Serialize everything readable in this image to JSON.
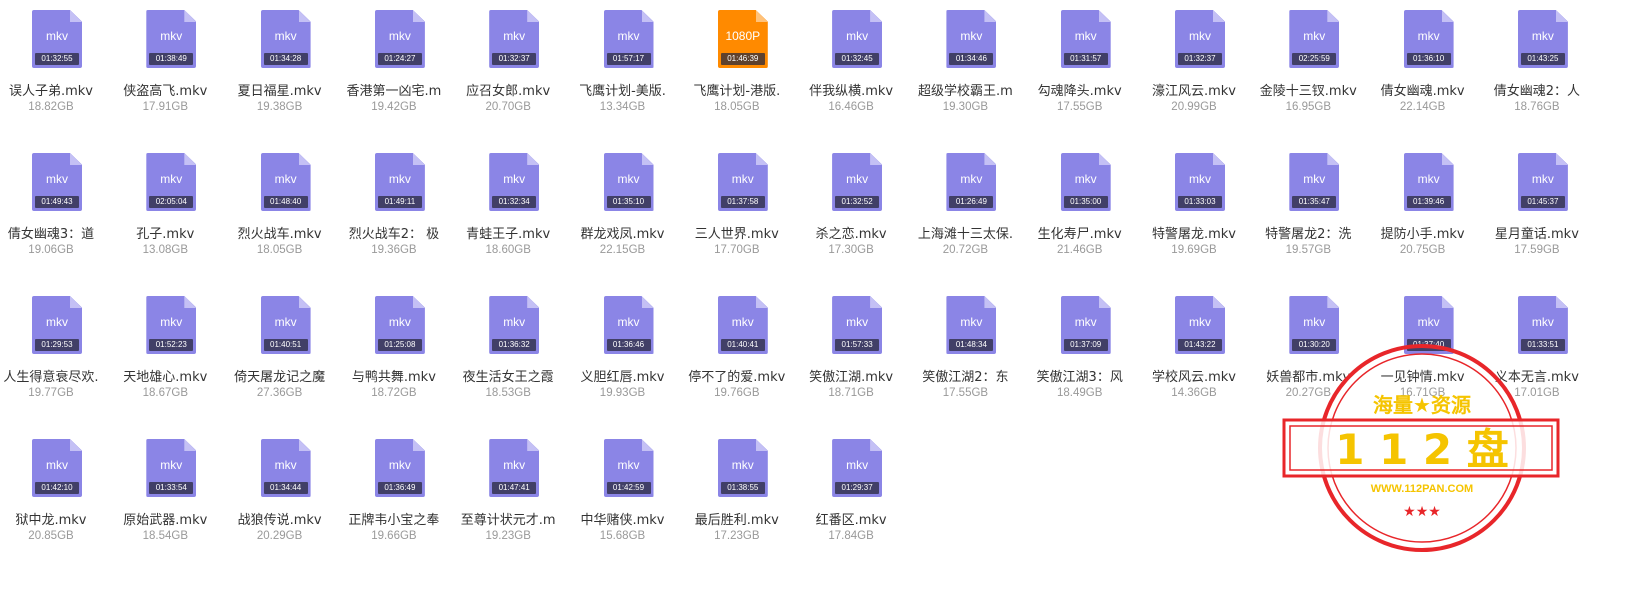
{
  "files": [
    {
      "name": "误人子弟.mkv",
      "size": "18.82GB",
      "duration": "01:32:55",
      "ext": "mkv"
    },
    {
      "name": "侠盗高飞.mkv",
      "size": "17.91GB",
      "duration": "01:38:49",
      "ext": "mkv"
    },
    {
      "name": "夏日福星.mkv",
      "size": "19.38GB",
      "duration": "01:34:28",
      "ext": "mkv"
    },
    {
      "name": "香港第一凶宅.m",
      "size": "19.42GB",
      "duration": "01:24:27",
      "ext": "mkv"
    },
    {
      "name": "应召女郎.mkv",
      "size": "20.70GB",
      "duration": "01:32:37",
      "ext": "mkv"
    },
    {
      "name": "飞鹰计划-美版.",
      "size": "13.34GB",
      "duration": "01:57:17",
      "ext": "mkv"
    },
    {
      "name": "飞鹰计划-港版.",
      "size": "18.05GB",
      "duration": "01:46:39",
      "ext": "1080P",
      "accent": "orange"
    },
    {
      "name": "伴我纵横.mkv",
      "size": "16.46GB",
      "duration": "01:32:45",
      "ext": "mkv"
    },
    {
      "name": "超级学校霸王.m",
      "size": "19.30GB",
      "duration": "01:34:46",
      "ext": "mkv"
    },
    {
      "name": "勾魂降头.mkv",
      "size": "17.55GB",
      "duration": "01:31:57",
      "ext": "mkv"
    },
    {
      "name": "濠江风云.mkv",
      "size": "20.99GB",
      "duration": "01:32:37",
      "ext": "mkv"
    },
    {
      "name": "金陵十三钗.mkv",
      "size": "16.95GB",
      "duration": "02:25:59",
      "ext": "mkv"
    },
    {
      "name": "倩女幽魂.mkv",
      "size": "22.14GB",
      "duration": "01:36:10",
      "ext": "mkv"
    },
    {
      "name": "倩女幽魂2：人",
      "size": "18.76GB",
      "duration": "01:43:25",
      "ext": "mkv"
    },
    {
      "name": "倩女幽魂3：道",
      "size": "19.06GB",
      "duration": "01:49:43",
      "ext": "mkv"
    },
    {
      "name": "孔子.mkv",
      "size": "13.08GB",
      "duration": "02:05:04",
      "ext": "mkv"
    },
    {
      "name": "烈火战车.mkv",
      "size": "18.05GB",
      "duration": "01:48:40",
      "ext": "mkv"
    },
    {
      "name": "烈火战车2： 极",
      "size": "19.36GB",
      "duration": "01:49:11",
      "ext": "mkv"
    },
    {
      "name": "青蛙王子.mkv",
      "size": "18.60GB",
      "duration": "01:32:34",
      "ext": "mkv"
    },
    {
      "name": "群龙戏凤.mkv",
      "size": "22.15GB",
      "duration": "01:35:10",
      "ext": "mkv"
    },
    {
      "name": "三人世界.mkv",
      "size": "17.70GB",
      "duration": "01:37:58",
      "ext": "mkv"
    },
    {
      "name": "杀之恋.mkv",
      "size": "17.30GB",
      "duration": "01:32:52",
      "ext": "mkv"
    },
    {
      "name": "上海滩十三太保.",
      "size": "20.72GB",
      "duration": "01:26:49",
      "ext": "mkv"
    },
    {
      "name": "生化寿尸.mkv",
      "size": "21.46GB",
      "duration": "01:35:00",
      "ext": "mkv"
    },
    {
      "name": "特警屠龙.mkv",
      "size": "19.69GB",
      "duration": "01:33:03",
      "ext": "mkv"
    },
    {
      "name": "特警屠龙2：洗",
      "size": "19.57GB",
      "duration": "01:35:47",
      "ext": "mkv"
    },
    {
      "name": "提防小手.mkv",
      "size": "20.75GB",
      "duration": "01:39:46",
      "ext": "mkv"
    },
    {
      "name": "星月童话.mkv",
      "size": "17.59GB",
      "duration": "01:45:37",
      "ext": "mkv"
    },
    {
      "name": "人生得意衰尽欢.",
      "size": "19.77GB",
      "duration": "01:29:53",
      "ext": "mkv"
    },
    {
      "name": "天地雄心.mkv",
      "size": "18.67GB",
      "duration": "01:52:23",
      "ext": "mkv"
    },
    {
      "name": "倚天屠龙记之魔",
      "size": "27.36GB",
      "duration": "01:40:51",
      "ext": "mkv"
    },
    {
      "name": "与鸭共舞.mkv",
      "size": "18.72GB",
      "duration": "01:25:08",
      "ext": "mkv"
    },
    {
      "name": "夜生活女王之霞",
      "size": "18.53GB",
      "duration": "01:36:32",
      "ext": "mkv"
    },
    {
      "name": "义胆红唇.mkv",
      "size": "19.93GB",
      "duration": "01:36:46",
      "ext": "mkv"
    },
    {
      "name": "停不了的爱.mkv",
      "size": "19.76GB",
      "duration": "01:40:41",
      "ext": "mkv"
    },
    {
      "name": "笑傲江湖.mkv",
      "size": "18.71GB",
      "duration": "01:57:33",
      "ext": "mkv"
    },
    {
      "name": "笑傲江湖2：东",
      "size": "17.55GB",
      "duration": "01:48:34",
      "ext": "mkv"
    },
    {
      "name": "笑傲江湖3：风",
      "size": "18.49GB",
      "duration": "01:37:09",
      "ext": "mkv"
    },
    {
      "name": "学校风云.mkv",
      "size": "14.36GB",
      "duration": "01:43:22",
      "ext": "mkv"
    },
    {
      "name": "妖兽都市.mkv",
      "size": "20.27GB",
      "duration": "01:30:20",
      "ext": "mkv"
    },
    {
      "name": "一见钟情.mkv",
      "size": "16.71GB",
      "duration": "01:37:40",
      "ext": "mkv"
    },
    {
      "name": "义本无言.mkv",
      "size": "17.01GB",
      "duration": "01:33:51",
      "ext": "mkv"
    },
    {
      "name": "狱中龙.mkv",
      "size": "20.85GB",
      "duration": "01:42:10",
      "ext": "mkv"
    },
    {
      "name": "原始武器.mkv",
      "size": "18.54GB",
      "duration": "01:33:54",
      "ext": "mkv"
    },
    {
      "name": "战狼传说.mkv",
      "size": "20.29GB",
      "duration": "01:34:44",
      "ext": "mkv"
    },
    {
      "name": "正牌韦小宝之奉",
      "size": "19.66GB",
      "duration": "01:36:49",
      "ext": "mkv"
    },
    {
      "name": "至尊计状元才.m",
      "size": "19.23GB",
      "duration": "01:47:41",
      "ext": "mkv"
    },
    {
      "name": "中华赌侠.mkv",
      "size": "15.68GB",
      "duration": "01:42:59",
      "ext": "mkv"
    },
    {
      "name": "最后胜利.mkv",
      "size": "17.23GB",
      "duration": "01:38:55",
      "ext": "mkv"
    },
    {
      "name": "红番区.mkv",
      "size": "17.84GB",
      "duration": "01:29:37",
      "ext": "mkv"
    }
  ],
  "watermark": {
    "top_text": "海量★资源",
    "main_text": "1 1 2 盘",
    "url": "WWW.112PAN.COM",
    "color": "#e8262a",
    "accent": "#f5c400"
  }
}
